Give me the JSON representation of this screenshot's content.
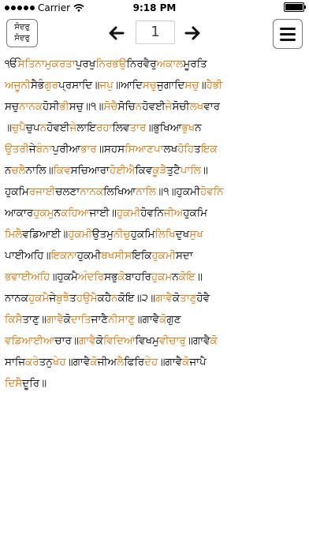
{
  "status_bar": {
    "carrier": "Carrier",
    "time": "9:18 PM"
  },
  "toolbar": {
    "gurmukhi_toggle_line1": "ਸੋਦਰੁ",
    "gurmukhi_toggle_line2": "ਸੋਦਰੁ",
    "page_number": "1"
  },
  "colors": {
    "accent_orange": "#e07b1a",
    "text_black": "#111111"
  },
  "gurbani_lines": [
    [
      [
        "ੴ",
        "black"
      ],
      [
        "ਸਤਿਨਾਮੁ",
        "orange"
      ],
      [
        "ਕਰਤਾ",
        "orange"
      ],
      [
        "ਪੁਰਖੁ",
        "black"
      ],
      [
        "ਨਿਰਭਉ",
        "orange"
      ],
      [
        "ਨਿਰਵੈਰੁ",
        "black"
      ],
      [
        "ਅਕਾਲ",
        "orange"
      ],
      [
        "ਮੂਰਤਿ",
        "black"
      ]
    ],
    [
      [
        "ਅਜੂਨੀ",
        "orange"
      ],
      [
        "ਸੈਭੰ",
        "black"
      ],
      [
        "ਗੁਰ",
        "orange"
      ],
      [
        "ਪ੍ਰਸਾਦਿ॥",
        "black"
      ],
      [
        "ਜਪੁ",
        "orange"
      ],
      [
        "॥ਆਦਿ",
        "black"
      ],
      [
        "ਸਚੁ",
        "orange"
      ],
      [
        "ਜੁਗਾਦਿ",
        "black"
      ],
      [
        "ਸਚੁ",
        "orange"
      ],
      [
        "॥",
        "black"
      ],
      [
        "ਹੈਭੀ",
        "orange"
      ]
    ],
    [
      [
        "ਸਚੁ",
        "black"
      ],
      [
        "ਨਾਨਕ",
        "orange"
      ],
      [
        "ਹੋਸੀ",
        "black"
      ],
      [
        "ਭੀ",
        "orange"
      ],
      [
        "ਸਚੁ॥੧॥",
        "black"
      ],
      [
        "ਸੋਚੈ",
        "orange"
      ],
      [
        "ਸੋਚਿ",
        "black"
      ],
      [
        "ਨ",
        "orange"
      ],
      [
        "ਹੋਵਈ",
        "black"
      ],
      [
        "ਜੇ",
        "orange"
      ],
      [
        "ਸੋਚੀ",
        "black"
      ],
      [
        "ਲਖ",
        "orange"
      ],
      [
        "ਵਾਰ",
        "black"
      ]
    ],
    [
      [
        "॥",
        "black"
      ],
      [
        "ਚੁਪੈ",
        "orange"
      ],
      [
        "ਚੁਪ",
        "black"
      ],
      [
        "ਨ",
        "orange"
      ],
      [
        "ਹੋਵਈ",
        "black"
      ],
      [
        "ਜੇ",
        "orange"
      ],
      [
        "ਲਾਇ",
        "black"
      ],
      [
        "ਰਹਾ",
        "orange"
      ],
      [
        "ਲਿਵ",
        "black"
      ],
      [
        "ਤਾਰ",
        "orange"
      ],
      [
        "॥ਭੁਖਿਆ",
        "black"
      ],
      [
        "ਭੁਖ",
        "orange"
      ],
      [
        "ਨ",
        "black"
      ]
    ],
    [
      [
        "ਉਤਰੀ",
        "orange"
      ],
      [
        "ਜੇ",
        "black"
      ],
      [
        "ਬੰਨਾ",
        "orange"
      ],
      [
        "ਪੁਰੀਆ",
        "black"
      ],
      [
        "ਭਾਰ",
        "orange"
      ],
      [
        "॥ਸਹਸ",
        "black"
      ],
      [
        "ਸਿਆਣਪਾ",
        "orange"
      ],
      [
        "ਲਖ",
        "black"
      ],
      [
        "ਹੋਹਿ",
        "orange"
      ],
      [
        "ਤ",
        "black"
      ],
      [
        "ਇਕ",
        "orange"
      ]
    ],
    [
      [
        "ਨ",
        "black"
      ],
      [
        "ਚਲੈ",
        "orange"
      ],
      [
        "ਨਾਲਿ॥",
        "black"
      ],
      [
        "ਕਿਵ",
        "orange"
      ],
      [
        "ਸਚਿਆਰਾ",
        "black"
      ],
      [
        "ਹੋਈਐ",
        "orange"
      ],
      [
        "ਕਿਵ",
        "black"
      ],
      [
        "ਕੂੜੈ",
        "orange"
      ],
      [
        "ਤੁਟੈ",
        "black"
      ],
      [
        "ਪਾਲਿ",
        "orange"
      ],
      [
        "॥",
        "black"
      ]
    ],
    [
      [
        "ਹੁਕਮਿ",
        "black"
      ],
      [
        "ਰਜਾਈ",
        "orange"
      ],
      [
        "ਚਲਣਾ",
        "black"
      ],
      [
        "ਨਾਨਕ",
        "orange"
      ],
      [
        "ਲਿਖਿਆ",
        "black"
      ],
      [
        "ਨਾਲਿ",
        "orange"
      ],
      [
        "॥੧॥ਹੁਕਮੀ",
        "black"
      ],
      [
        "ਹੋਵਨਿ",
        "orange"
      ]
    ],
    [
      [
        "ਆਕਾਰ",
        "black"
      ],
      [
        "ਹੁਕਮੁ",
        "orange"
      ],
      [
        "ਨ",
        "black"
      ],
      [
        "ਕਹਿਆ",
        "orange"
      ],
      [
        "ਜਾਈ॥",
        "black"
      ],
      [
        "ਹੁਕਮੀ",
        "orange"
      ],
      [
        "ਹੋਵਨਿ",
        "black"
      ],
      [
        "ਜੀਅ",
        "orange"
      ],
      [
        "ਹੁਕਮਿ",
        "black"
      ]
    ],
    [
      [
        "ਮਿਲੈ",
        "orange"
      ],
      [
        "ਵਡਿਆਈ॥",
        "black"
      ],
      [
        "ਹੁਕਮੀ",
        "orange"
      ],
      [
        "ਉਤਮੁ",
        "black"
      ],
      [
        "ਨੀਚੁ",
        "orange"
      ],
      [
        "ਹੁਕਮਿ",
        "black"
      ],
      [
        "ਲਿਖਿ",
        "orange"
      ],
      [
        "ਦੁਖ",
        "black"
      ],
      [
        "ਸੁਖ",
        "orange"
      ]
    ],
    [
      [
        "ਪਾਈਅਹਿ॥",
        "black"
      ],
      [
        "ਇਕਨਾ",
        "orange"
      ],
      [
        "ਹੁਕਮੀ",
        "black"
      ],
      [
        "ਬਖਸੀਸ",
        "orange"
      ],
      [
        "ਇਕਿ",
        "black"
      ],
      [
        "ਹੁਕਮੀ",
        "orange"
      ],
      [
        "ਸਦਾ",
        "black"
      ]
    ],
    [
      [
        "ਭਵਾਈਅਹਿ",
        "orange"
      ],
      [
        "॥ਹੁਕਮੈ",
        "black"
      ],
      [
        "ਅੰਦਰਿ",
        "orange"
      ],
      [
        "ਸਭੁ",
        "black"
      ],
      [
        "ਕੋ",
        "orange"
      ],
      [
        "ਬਾਹਰਿ",
        "black"
      ],
      [
        "ਹੁਕਮ",
        "orange"
      ],
      [
        "ਨ",
        "black"
      ],
      [
        "ਕੋਇ",
        "orange"
      ],
      [
        "॥",
        "black"
      ]
    ],
    [
      [
        "ਨਾਨਕ",
        "black"
      ],
      [
        "ਹੁਕਮੈ",
        "orange"
      ],
      [
        "ਜੇ",
        "black"
      ],
      [
        "ਬੁਝੈ",
        "orange"
      ],
      [
        "ਤ",
        "black"
      ],
      [
        "ਹਉਮੈ",
        "orange"
      ],
      [
        "ਕਹੈ",
        "black"
      ],
      [
        "ਨ",
        "orange"
      ],
      [
        "ਕੋਇ॥੨॥",
        "black"
      ],
      [
        "ਗਾਵੈ",
        "orange"
      ],
      [
        "ਕੋ",
        "black"
      ],
      [
        "ਤਾਣੁ",
        "orange"
      ],
      [
        "ਹੋਵੈ",
        "black"
      ]
    ],
    [
      [
        "ਕਿਸੈ",
        "orange"
      ],
      [
        "ਤਾਣੁ॥",
        "black"
      ],
      [
        "ਗਾਵੈ",
        "orange"
      ],
      [
        "ਕੋ",
        "black"
      ],
      [
        "ਦਾਤਿ",
        "orange"
      ],
      [
        "ਜਾਣੈ",
        "black"
      ],
      [
        "ਨੀਸਾਣੁ",
        "orange"
      ],
      [
        "॥ਗਾਵੈ",
        "black"
      ],
      [
        "ਕੋ",
        "orange"
      ],
      [
        "ਗੁਣ",
        "black"
      ]
    ],
    [
      [
        "ਵਡਿਆਈਆ",
        "orange"
      ],
      [
        "ਚਾਰ॥",
        "black"
      ],
      [
        "ਗਾਵੈ",
        "orange"
      ],
      [
        "ਕੋ",
        "black"
      ],
      [
        "ਵਿਦਿਆ",
        "orange"
      ],
      [
        "ਵਿਖਮੁ",
        "black"
      ],
      [
        "ਵੀਚਾਰੁ",
        "orange"
      ],
      [
        "॥ਗਾਵੈ",
        "black"
      ],
      [
        "ਕੋ",
        "orange"
      ]
    ],
    [
      [
        "ਸਾਜਿ",
        "black"
      ],
      [
        "ਕਰੇ",
        "orange"
      ],
      [
        "ਤਨੁ",
        "black"
      ],
      [
        "ਖੇਹ",
        "orange"
      ],
      [
        "॥ਗਾਵੈ",
        "black"
      ],
      [
        "ਕੋ",
        "orange"
      ],
      [
        "ਜੀਅ",
        "black"
      ],
      [
        "ਲੈ",
        "orange"
      ],
      [
        "ਫਿਰਿ",
        "black"
      ],
      [
        "ਦੇਹ",
        "orange"
      ],
      [
        "॥ਗਾਵੈ",
        "black"
      ],
      [
        "ਕੋ",
        "orange"
      ],
      [
        "ਜਾਪੈ",
        "black"
      ]
    ],
    [
      [
        "ਦਿਸੈ",
        "orange"
      ],
      [
        "ਦੂਰਿ",
        "black"
      ],
      [
        "॥",
        "black"
      ]
    ]
  ]
}
